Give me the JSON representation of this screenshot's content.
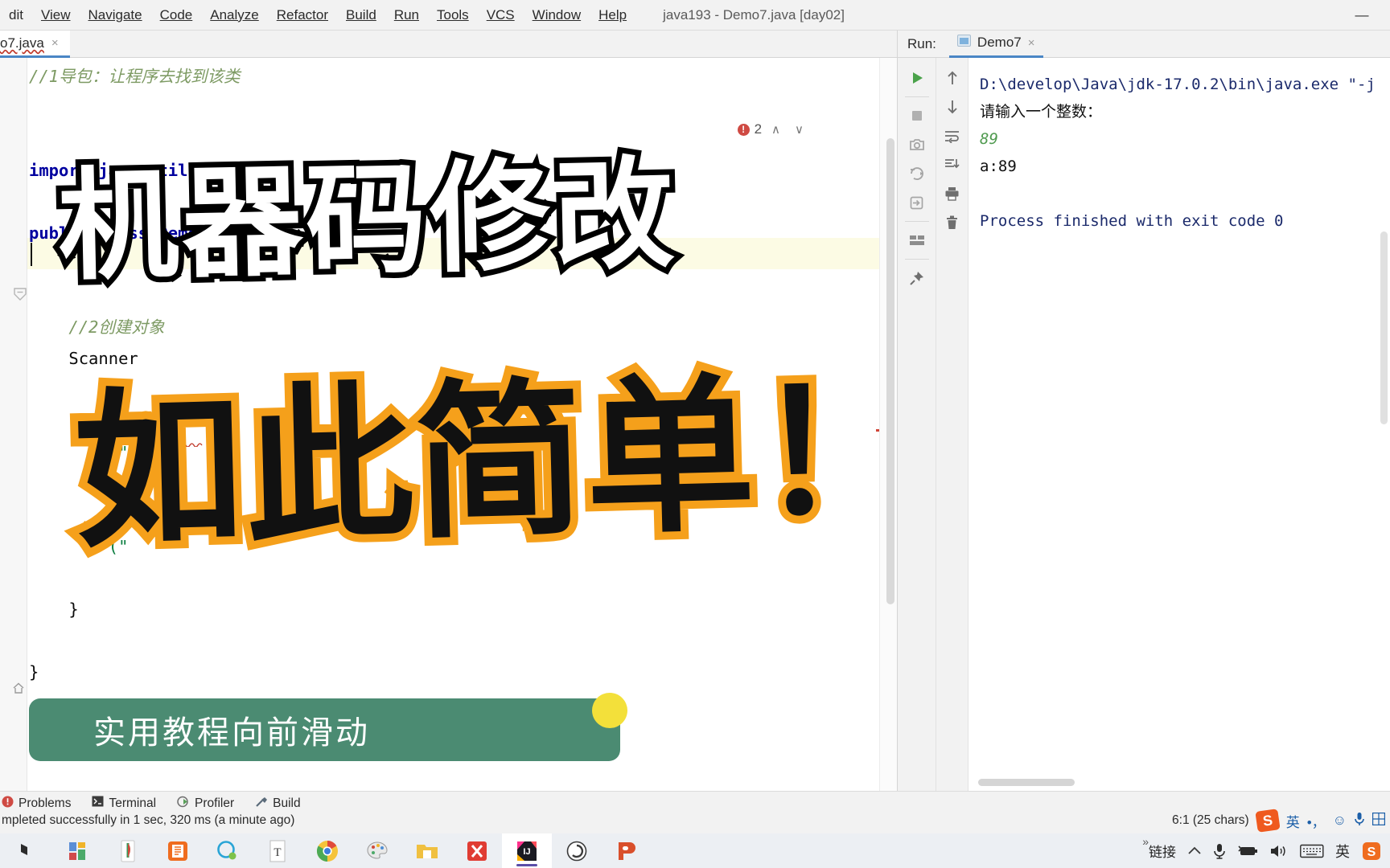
{
  "window": {
    "title": "java193 - Demo7.java [day02]",
    "minimize_label": "—"
  },
  "menubar": {
    "items": [
      {
        "label": "dit",
        "mnemonic": ""
      },
      {
        "label": "View",
        "mnemonic": "V"
      },
      {
        "label": "Navigate",
        "mnemonic": "N"
      },
      {
        "label": "Code",
        "mnemonic": "C"
      },
      {
        "label": "Analyze",
        "mnemonic": "z"
      },
      {
        "label": "Refactor",
        "mnemonic": "R"
      },
      {
        "label": "Build",
        "mnemonic": "B"
      },
      {
        "label": "Run",
        "mnemonic": "u"
      },
      {
        "label": "Tools",
        "mnemonic": "T"
      },
      {
        "label": "VCS",
        "mnemonic": "S"
      },
      {
        "label": "Window",
        "mnemonic": "W"
      },
      {
        "label": "Help",
        "mnemonic": "H"
      }
    ]
  },
  "editor": {
    "tab_label": "o7.java",
    "tab_close": "×",
    "error_count": "2",
    "error_badge": "!",
    "prev_chevron": "∧",
    "next_chevron": "∨",
    "lines": [
      {
        "text": "//1导包：让程序去找到该类",
        "kind": "comment"
      },
      {
        "text": "",
        "kind": "plain"
      },
      {
        "text": "",
        "kind": "plain"
      },
      {
        "text": "import java.util.Scanner;",
        "kind": "import"
      },
      {
        "text": "",
        "kind": "caret"
      },
      {
        "text": "public class Demo7 {",
        "kind": "code"
      },
      {
        "text": "",
        "kind": "plain"
      },
      {
        "text": "",
        "kind": "plain"
      },
      {
        "text": "    //2创建对象",
        "kind": "comment"
      },
      {
        "text": "    Scanner",
        "kind": "code"
      },
      {
        "text": "",
        "kind": "plain"
      },
      {
        "text": "        )",
        "kind": "code"
      },
      {
        "text": "        (\"请输",
        "kind": "code"
      },
      {
        "text": "        ()",
        "kind": "code"
      },
      {
        "text": "",
        "kind": "plain"
      },
      {
        "text": "        (\"",
        "kind": "code"
      },
      {
        "text": "",
        "kind": "plain"
      },
      {
        "text": "    }",
        "kind": "code"
      },
      {
        "text": "",
        "kind": "plain"
      },
      {
        "text": "}",
        "kind": "code"
      }
    ]
  },
  "run_panel": {
    "label": "Run:",
    "tab_label": "Demo7",
    "tab_close": "×",
    "toolbar_primary": [
      "run-icon",
      "stop-icon",
      "camera-icon",
      "restart-icon",
      "exit-icon",
      "layout-icon",
      "pin-icon"
    ],
    "toolbar_secondary": [
      "scroll-up-icon",
      "scroll-down-icon",
      "soft-wrap-icon",
      "scroll-to-end-icon",
      "print-icon",
      "trash-icon"
    ],
    "console_lines": [
      {
        "text": "D:\\develop\\Java\\jdk-17.0.2\\bin\\java.exe \"-j",
        "style": "blue"
      },
      {
        "text": "请输入一个整数：",
        "style": "plain"
      },
      {
        "text": "89",
        "style": "green"
      },
      {
        "text": "a:89",
        "style": "plain"
      },
      {
        "text": "",
        "style": "plain"
      },
      {
        "text": "Process finished with exit code 0",
        "style": "blue"
      }
    ]
  },
  "overlay": {
    "top_caption": "机器码修改",
    "bottom_caption": "如此简单！",
    "banner_text": "实用教程向前滑动",
    "colors": {
      "top_stroke": "#000000",
      "top_fill": "#ffffff",
      "bottom_stroke": "#F5A01B",
      "bottom_fill": "#111111",
      "banner_bg": "#4b8b72",
      "dot_yellow": "#f3e03a",
      "dot_green": "#3f8f6d"
    }
  },
  "bottom_toolwindows": {
    "items": [
      {
        "label": "Problems",
        "icon": "problems-icon"
      },
      {
        "label": "Terminal",
        "icon": "terminal-icon"
      },
      {
        "label": "Profiler",
        "icon": "profiler-icon"
      },
      {
        "label": "Build",
        "icon": "build-icon"
      }
    ]
  },
  "statusbar": {
    "message": "mpleted successfully in 1 sec, 320 ms (a minute ago)",
    "caret_position": "6:1 (25 chars)",
    "ime": {
      "lang": "英",
      "punct": "•，",
      "emoji": "☺",
      "mic": "mic-icon",
      "panel": "panel-icon"
    }
  },
  "taskbar": {
    "apps": [
      {
        "name": "windows-start-icon",
        "active": false
      },
      {
        "name": "office-icon",
        "active": false
      },
      {
        "name": "pdf-icon",
        "active": false
      },
      {
        "name": "wps-icon",
        "active": false
      },
      {
        "name": "qq-icon",
        "active": false
      },
      {
        "name": "typora-icon",
        "active": false
      },
      {
        "name": "chrome-icon",
        "active": false
      },
      {
        "name": "paint-icon",
        "active": false
      },
      {
        "name": "explorer-icon",
        "active": false
      },
      {
        "name": "xmind-icon",
        "active": false
      },
      {
        "name": "intellij-idea-icon",
        "active": true
      },
      {
        "name": "clock-icon",
        "active": false
      },
      {
        "name": "powerpoint-icon",
        "active": false
      }
    ],
    "tray": {
      "link_label": "链接",
      "overflow": "»",
      "chevron": "∧",
      "ime_lang": "英",
      "sogou": "S"
    }
  }
}
